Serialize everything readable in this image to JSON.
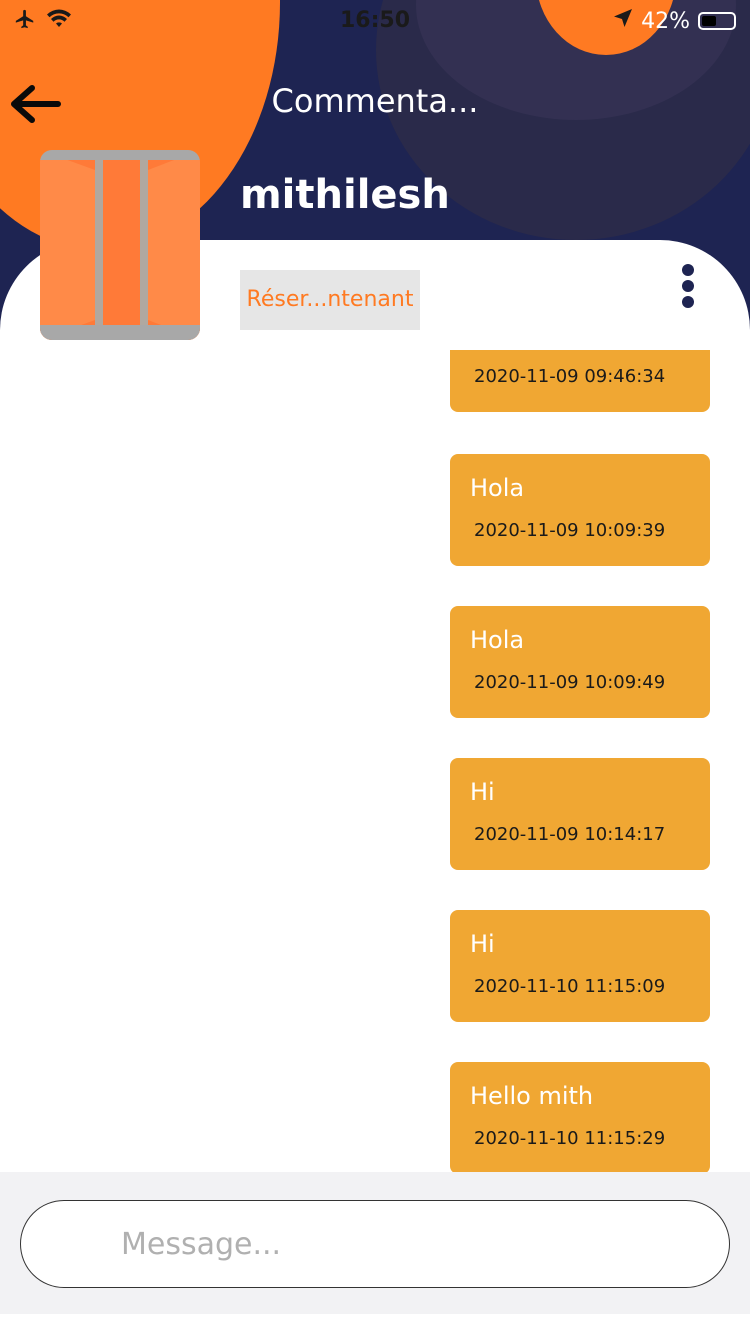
{
  "status_bar": {
    "time": "16:50",
    "battery": "42%",
    "icons": [
      "airplane-icon",
      "wifi-icon",
      "location-arrow-icon",
      "battery-icon"
    ]
  },
  "header": {
    "title": "Commenta...",
    "back_icon": "arrow-left-icon",
    "username": "mithilesh",
    "reserve_label": "Réser...ntenant",
    "more_icon": "vertical-dots-icon"
  },
  "colors": {
    "header_bg": "#1e2452",
    "accent_orange": "#ff7a22",
    "bubble": "#f0a733"
  },
  "messages": [
    {
      "text": "",
      "time": "2020-11-09 09:46:34"
    },
    {
      "text": "Hola",
      "time": "2020-11-09 10:09:39"
    },
    {
      "text": "Hola",
      "time": "2020-11-09 10:09:49"
    },
    {
      "text": "Hi",
      "time": "2020-11-09 10:14:17"
    },
    {
      "text": "Hi",
      "time": "2020-11-10 11:15:09"
    },
    {
      "text": "Hello mith",
      "time": "2020-11-10 11:15:29"
    }
  ],
  "composer": {
    "placeholder": "Message..."
  }
}
